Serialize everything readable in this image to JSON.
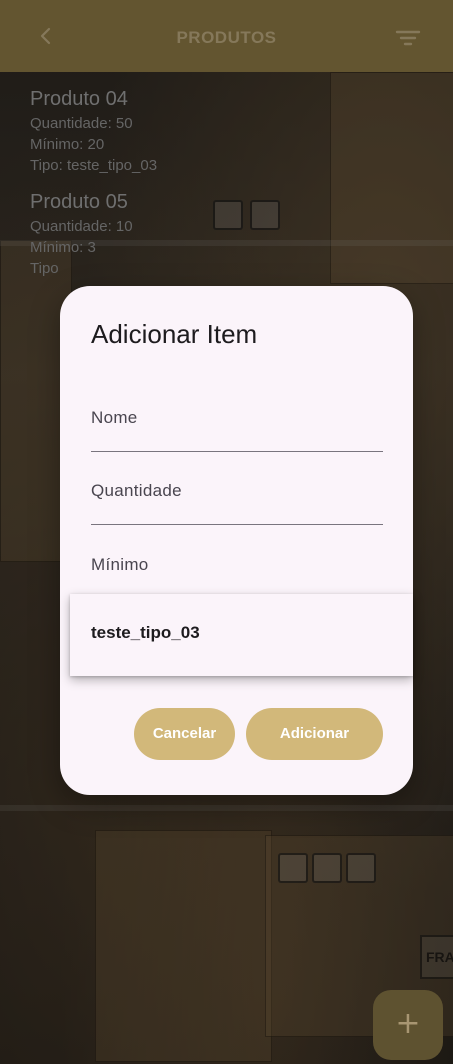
{
  "appbar": {
    "title": "PRODUTOS",
    "back_icon": "chevron-left-icon",
    "filter_icon": "filter-icon"
  },
  "products": [
    {
      "name": "Produto 04",
      "quantity": "Quantidade: 50",
      "minimum": "Mínimo: 20",
      "type": "Tipo: teste_tipo_03"
    },
    {
      "name": "Produto 05",
      "quantity": "Quantidade: 10",
      "minimum": "Mínimo: 3",
      "type": "Tipo"
    }
  ],
  "dialog": {
    "title": "Adicionar Item",
    "fields": {
      "name_placeholder": "Nome",
      "quantity_placeholder": "Quantidade",
      "minimum_placeholder": "Mínimo"
    },
    "dropdown": {
      "selected": "teste_tipo_03"
    },
    "buttons": {
      "cancel": "Cancelar",
      "add": "Adicionar"
    }
  },
  "background": {
    "fragile_label": "FRA"
  },
  "fab": {
    "label": "+",
    "icon": "plus-icon"
  },
  "colors": {
    "appbar": "#8a7643",
    "button": "#d2b87a",
    "dialog": "#fbf4fa",
    "fab": "#5e5230"
  }
}
